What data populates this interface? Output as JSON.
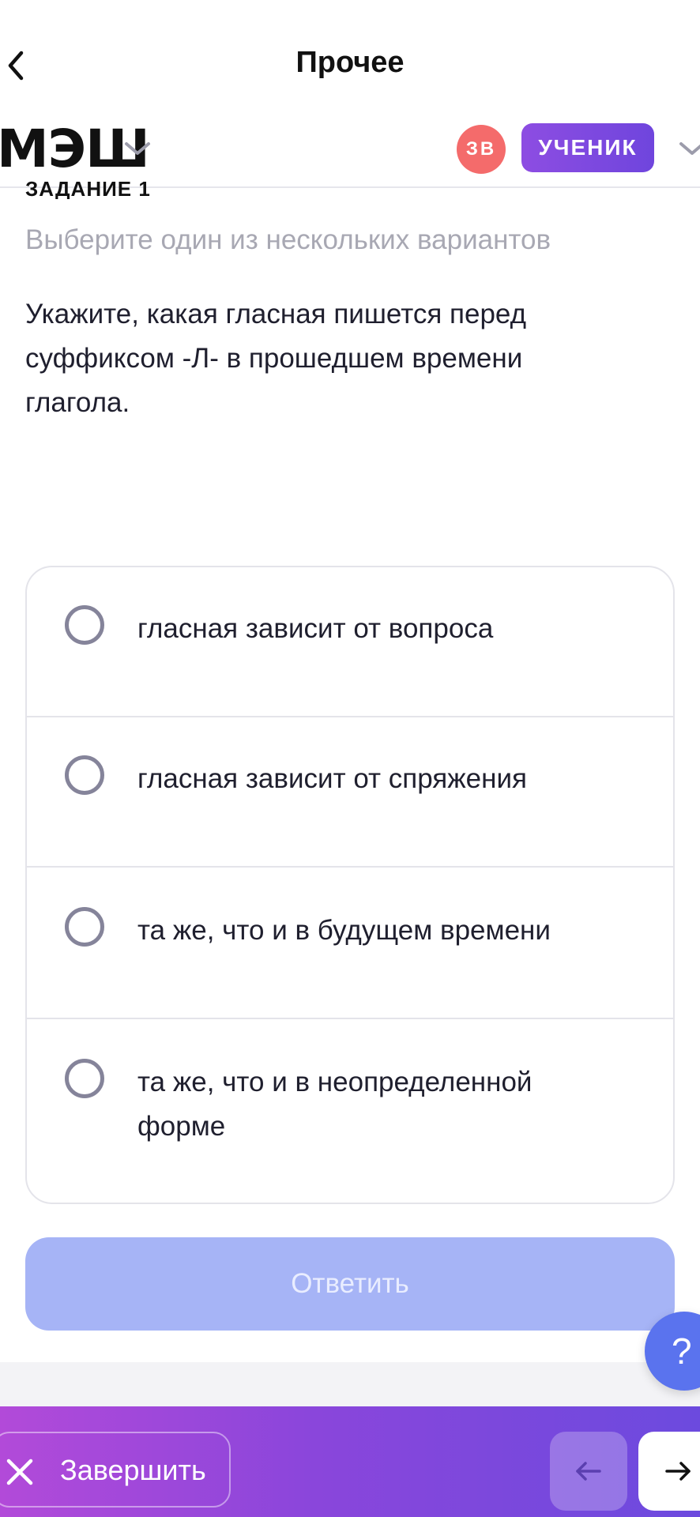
{
  "header": {
    "title": "Прочее"
  },
  "appbar": {
    "logo": "МЭШ",
    "avatar_initials": "ЗВ",
    "role": "УЧЕНИК"
  },
  "task": {
    "label": "ЗАДАНИЕ 1",
    "instruction": "Выберите один из нескольких вариантов",
    "question": "Укажите, какая гласная пишется перед суффиксом -Л- в прошедшем времени глагола.",
    "options": [
      "гласная зависит от вопроса",
      "гласная зависит от спряжения",
      "та же, что и в будущем времени",
      "та же, что и в неопределенной форме"
    ],
    "submit_label": "Ответить"
  },
  "help": {
    "label": "?"
  },
  "footer": {
    "finish_label": "Завершить"
  },
  "colors": {
    "accent_purple": "#7b48de",
    "submit_disabled": "#a6b4f6",
    "avatar_bg": "#f46b6b",
    "help_bg": "#5a73ee"
  }
}
